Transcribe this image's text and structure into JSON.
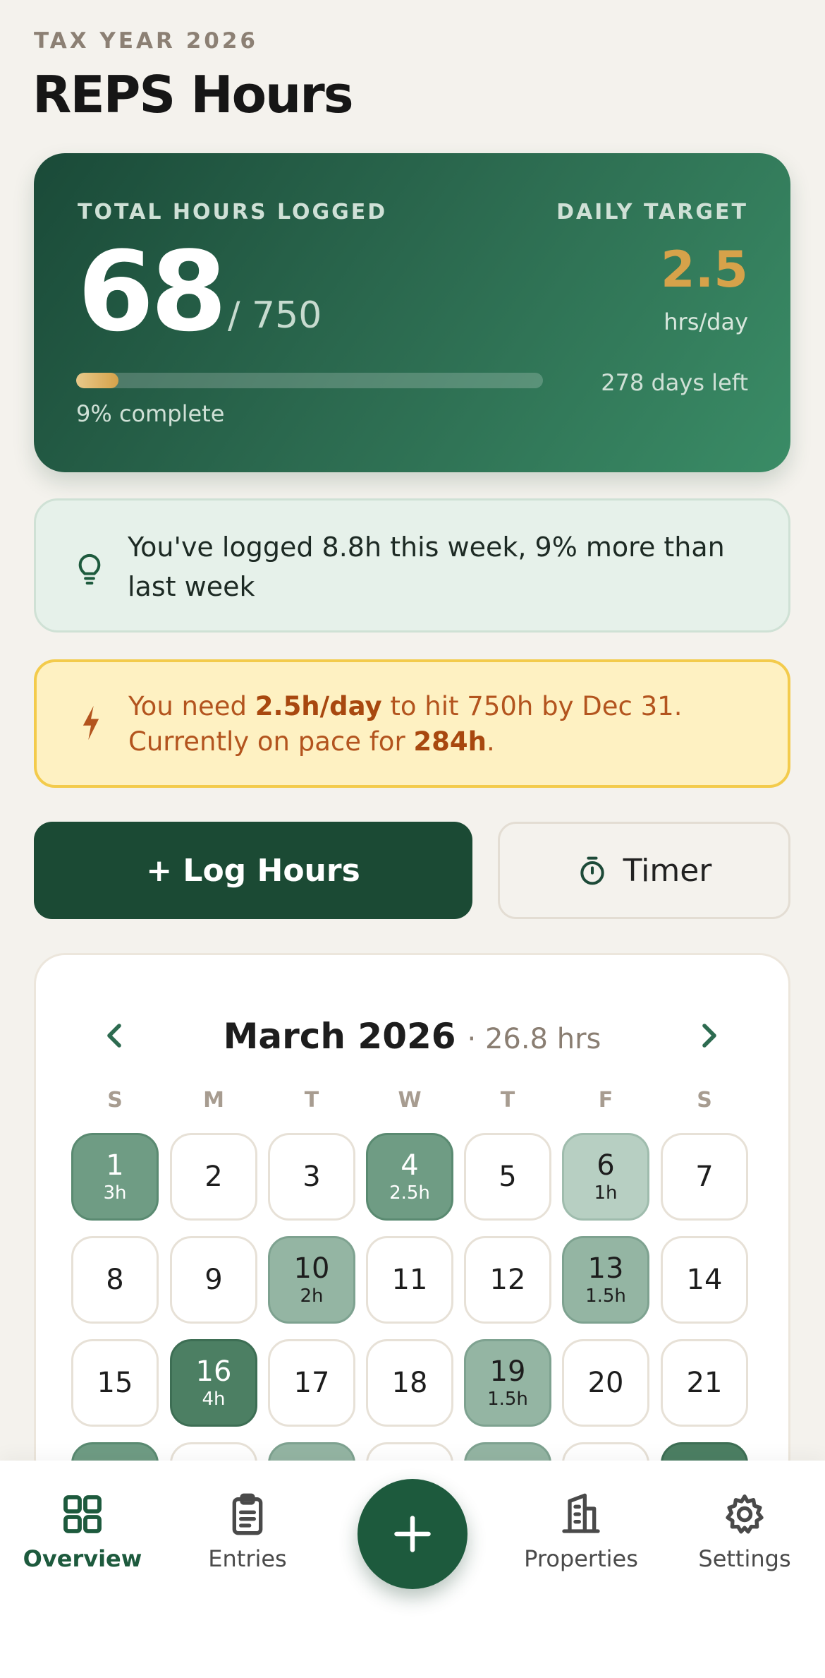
{
  "header": {
    "eyebrow": "TAX YEAR 2026",
    "title": "REPS Hours"
  },
  "summary": {
    "total_label": "TOTAL HOURS LOGGED",
    "total_value": "68",
    "goal": "/ 750",
    "progress_fraction": 0.09,
    "percent_text": "9% complete",
    "target_label": "DAILY TARGET",
    "target_value": "2.5",
    "target_unit": "hrs/day",
    "days_left": "278 days left",
    "colors": {
      "card_dark": "#1a4a38",
      "card_light": "#3a8c66",
      "accent_gold": "#d6a24a"
    }
  },
  "insight": {
    "icon": "lightbulb-icon",
    "text": "You've logged 8.8h this week, 9% more than last week"
  },
  "pace": {
    "icon": "lightning-icon",
    "line1_pre": "You need ",
    "line1_bold": "2.5h/day",
    "line1_post": " to hit 750h by Dec 31.",
    "line2_pre": "Currently on pace for ",
    "line2_bold": "284h",
    "line2_post": "."
  },
  "actions": {
    "log_label": "+ Log Hours",
    "timer_label": "Timer",
    "timer_icon": "stopwatch-icon"
  },
  "calendar": {
    "month": "March 2026",
    "total": "· 26.8 hrs",
    "weekdays": [
      "S",
      "M",
      "T",
      "W",
      "T",
      "F",
      "S"
    ],
    "days": [
      {
        "n": "1",
        "h": "3h",
        "level": 3
      },
      {
        "n": "2",
        "h": "",
        "level": 0
      },
      {
        "n": "3",
        "h": "",
        "level": 0
      },
      {
        "n": "4",
        "h": "2.5h",
        "level": 3
      },
      {
        "n": "5",
        "h": "",
        "level": 0
      },
      {
        "n": "6",
        "h": "1h",
        "level": 1
      },
      {
        "n": "7",
        "h": "",
        "level": 0
      },
      {
        "n": "8",
        "h": "",
        "level": 0
      },
      {
        "n": "9",
        "h": "",
        "level": 0
      },
      {
        "n": "10",
        "h": "2h",
        "level": 2
      },
      {
        "n": "11",
        "h": "",
        "level": 0
      },
      {
        "n": "12",
        "h": "",
        "level": 0
      },
      {
        "n": "13",
        "h": "1.5h",
        "level": 2
      },
      {
        "n": "14",
        "h": "",
        "level": 0
      },
      {
        "n": "15",
        "h": "",
        "level": 0
      },
      {
        "n": "16",
        "h": "4h",
        "level": 4
      },
      {
        "n": "17",
        "h": "",
        "level": 0
      },
      {
        "n": "18",
        "h": "",
        "level": 0
      },
      {
        "n": "19",
        "h": "1.5h",
        "level": 2
      },
      {
        "n": "20",
        "h": "",
        "level": 0
      },
      {
        "n": "21",
        "h": "",
        "level": 0
      },
      {
        "n": "",
        "h": "",
        "level": 3
      },
      {
        "n": "",
        "h": "",
        "level": 0
      },
      {
        "n": "",
        "h": "",
        "level": 2
      },
      {
        "n": "",
        "h": "",
        "level": 0
      },
      {
        "n": "",
        "h": "",
        "level": 2
      },
      {
        "n": "",
        "h": "",
        "level": 0
      },
      {
        "n": "",
        "h": "",
        "level": 4
      }
    ]
  },
  "nav": {
    "items": [
      {
        "label": "Overview",
        "icon": "grid-icon",
        "active": true
      },
      {
        "label": "Entries",
        "icon": "clipboard-icon",
        "active": false
      },
      {
        "label": "Properties",
        "icon": "building-icon",
        "active": false
      },
      {
        "label": "Settings",
        "icon": "gear-icon",
        "active": false
      }
    ],
    "fab_icon": "plus-icon"
  }
}
